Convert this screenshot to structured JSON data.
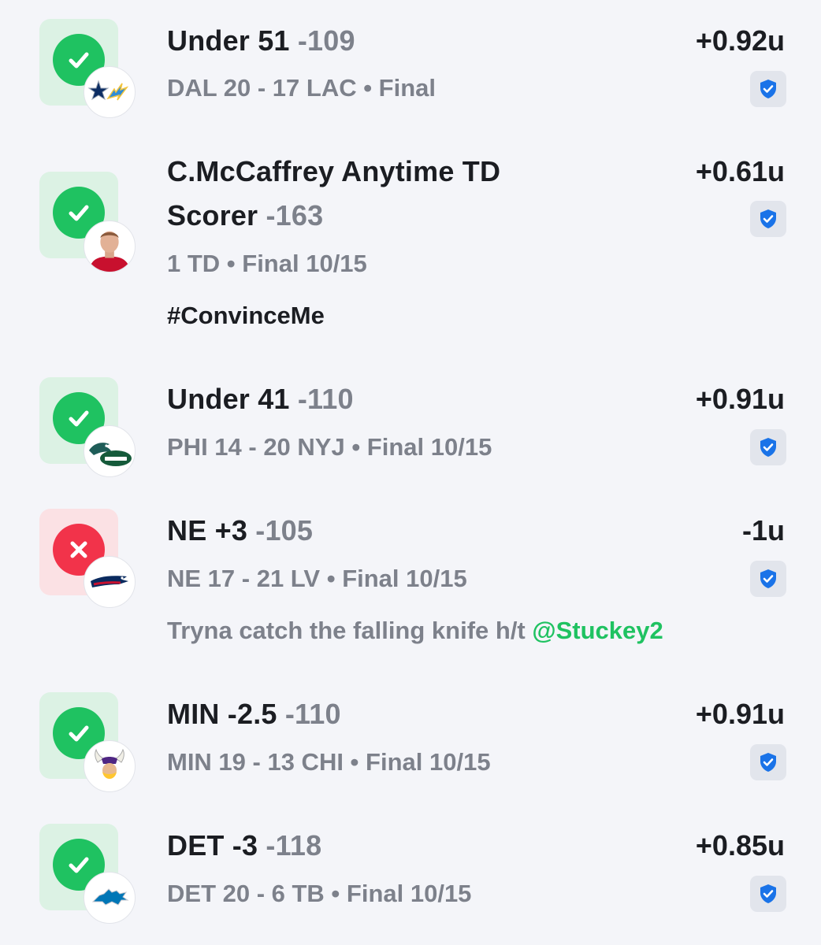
{
  "bets": [
    {
      "result": "win",
      "title": "Under 51",
      "odds": "-109",
      "subtitle": "DAL 20 - 17 LAC • Final",
      "units": "+0.92u",
      "logo": "cowboys-chargers-logo",
      "note": "",
      "mention": ""
    },
    {
      "result": "win",
      "title_line1": "C.McCaffrey Anytime TD",
      "title": "Scorer",
      "odds": "-163",
      "subtitle": "1 TD • Final 10/15",
      "units": "+0.61u",
      "logo": "player-headshot",
      "note": "#ConvinceMe",
      "mention": ""
    },
    {
      "result": "win",
      "title": "Under 41",
      "odds": "-110",
      "subtitle": "PHI 14 - 20 NYJ • Final 10/15",
      "units": "+0.91u",
      "logo": "eagles-jets-logo",
      "note": "",
      "mention": ""
    },
    {
      "result": "loss",
      "title": "NE +3",
      "odds": "-105",
      "subtitle": "NE 17 - 21 LV • Final 10/15",
      "units": "-1u",
      "logo": "patriots-logo",
      "note": "Tryna catch the falling knife h/t ",
      "mention": "@Stuckey2"
    },
    {
      "result": "win",
      "title": "MIN -2.5",
      "odds": "-110",
      "subtitle": "MIN 19 - 13 CHI • Final 10/15",
      "units": "+0.91u",
      "logo": "vikings-logo",
      "note": "",
      "mention": ""
    },
    {
      "result": "win",
      "title": "DET -3",
      "odds": "-118",
      "subtitle": "DET 20 - 6 TB • Final 10/15",
      "units": "+0.85u",
      "logo": "lions-logo",
      "note": "",
      "mention": ""
    }
  ],
  "colors": {
    "win": "#1fc261",
    "loss": "#f2334a",
    "verified": "#1a73e8",
    "muted": "#7d818b"
  },
  "icons": {
    "win": "check-icon",
    "loss": "x-icon",
    "verified": "verified-shield-icon"
  }
}
